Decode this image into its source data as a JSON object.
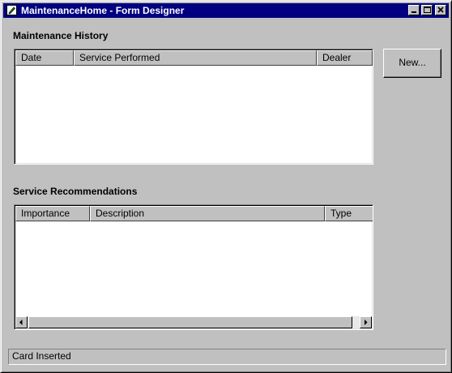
{
  "window": {
    "title": "MaintenanceHome - Form Designer",
    "icon": "pencil-document-icon",
    "controls": [
      "minimize-icon",
      "maximize-icon",
      "close-icon"
    ]
  },
  "maintenance_history": {
    "label": "Maintenance History",
    "columns": [
      "Date",
      "Service Performed",
      "Dealer"
    ],
    "rows": []
  },
  "new_button": {
    "label": "New..."
  },
  "service_recommendations": {
    "label": "Service Recommendations",
    "columns": [
      "Importance",
      "Description",
      "Type"
    ],
    "rows": []
  },
  "status": {
    "text": "Card Inserted"
  },
  "colors": {
    "titlebar": "#000080",
    "face": "#c0c0c0",
    "list_background": "#ffffff"
  }
}
